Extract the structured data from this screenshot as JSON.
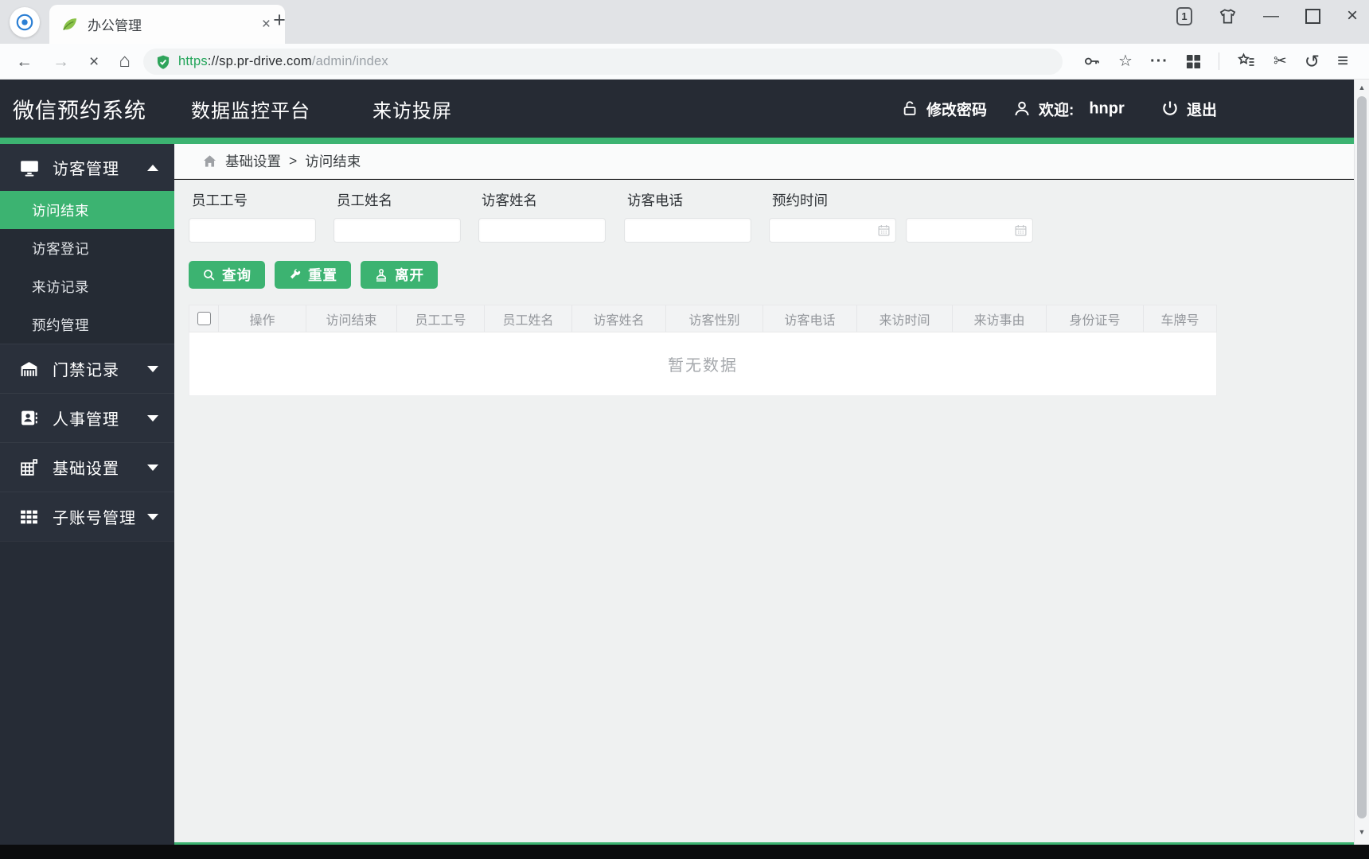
{
  "browser": {
    "tab_title": "办公管理",
    "tab_close": "×",
    "new_tab": "+",
    "window": {
      "tab_count": "1",
      "minimize": "—",
      "close": "×"
    },
    "address": {
      "scheme": "https",
      "host": "://sp.pr-drive.com",
      "path": "/admin/index"
    }
  },
  "icons": {
    "back": "←",
    "forward": "→",
    "stop": "×",
    "home": "⌂",
    "star": "☆",
    "more": "···",
    "scissors": "✂",
    "undo": "↺",
    "menu": "≡",
    "up": "▲",
    "down": "▼"
  },
  "header": {
    "brand": "微信预约系统",
    "nav_items": [
      {
        "label": "数据监控平台"
      },
      {
        "label": "来访投屏"
      }
    ],
    "change_password": "修改密码",
    "welcome_label": "欢迎:",
    "username": "hnpr",
    "logout": "退出"
  },
  "sidebar": {
    "groups": [
      {
        "label": "访客管理",
        "expanded": true,
        "children": [
          {
            "label": "访问结束",
            "active": true
          },
          {
            "label": "访客登记"
          },
          {
            "label": "来访记录"
          },
          {
            "label": "预约管理"
          }
        ]
      },
      {
        "label": "门禁记录"
      },
      {
        "label": "人事管理"
      },
      {
        "label": "基础设置"
      },
      {
        "label": "子账号管理"
      }
    ]
  },
  "breadcrumb": {
    "section": "基础设置",
    "separator": ">",
    "current": "访问结束"
  },
  "filters": [
    {
      "label": "员工工号",
      "value": ""
    },
    {
      "label": "员工姓名",
      "value": ""
    },
    {
      "label": "访客姓名",
      "value": ""
    },
    {
      "label": "访客电话",
      "value": ""
    },
    {
      "label": "预约时间",
      "value_start": "",
      "value_end": ""
    }
  ],
  "actions": {
    "search": "查询",
    "reset": "重置",
    "leave": "离开"
  },
  "table": {
    "headers": [
      "操作",
      "访问结束",
      "员工工号",
      "员工姓名",
      "访客姓名",
      "访客性别",
      "访客电话",
      "来访时间",
      "来访事由",
      "身份证号",
      "车牌号"
    ],
    "rows": [],
    "empty_text": "暂无数据"
  },
  "colors": {
    "accent_green": "#3cb371",
    "header_bg": "#262b34",
    "sidebar_bg": "#2a303b",
    "active_item_bg": "#3cb371",
    "url_secure_green": "#23a55a"
  }
}
